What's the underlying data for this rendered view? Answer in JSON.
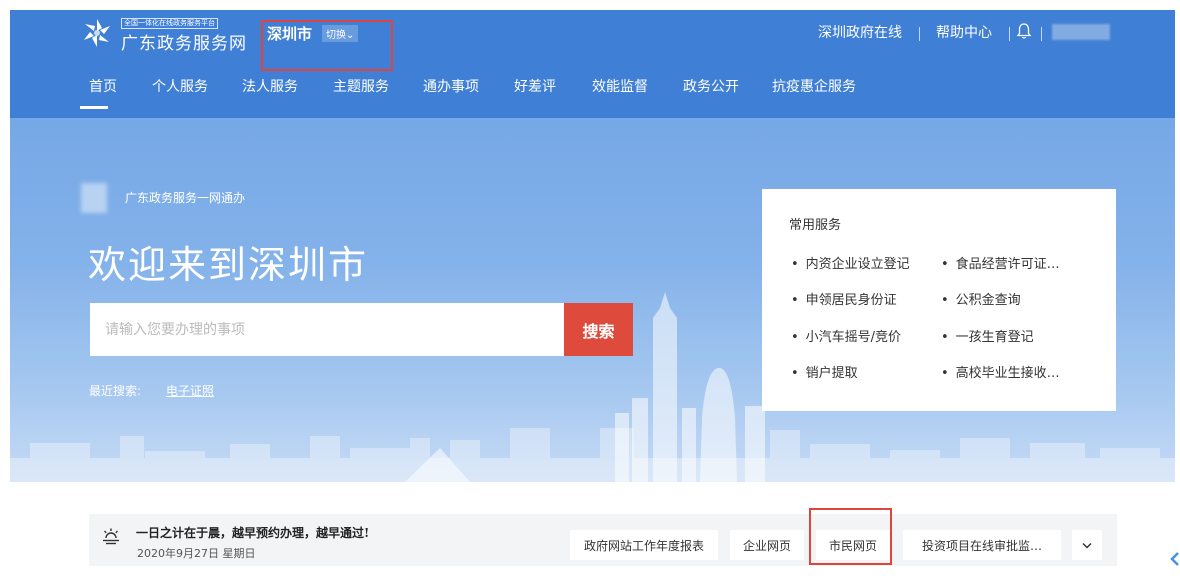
{
  "header": {
    "logo_tag": "全国一体化在线政务服务平台",
    "logo_title": "广东政务服务网",
    "city": "深圳市",
    "switch_label": "切换",
    "switch_chevron": "⌄",
    "gov_online": "深圳政府在线",
    "help_center": "帮助中心",
    "bell_icon": "bell-icon"
  },
  "nav": {
    "items": [
      {
        "label": "首页",
        "active": true
      },
      {
        "label": "个人服务"
      },
      {
        "label": "法人服务"
      },
      {
        "label": "主题服务"
      },
      {
        "label": "通办事项"
      },
      {
        "label": "好差评"
      },
      {
        "label": "效能监督"
      },
      {
        "label": "政务公开"
      },
      {
        "label": "抗疫惠企服务"
      }
    ]
  },
  "hero": {
    "subtitle": "广东政务服务一网通办",
    "title": "欢迎来到深圳市",
    "search_placeholder": "请输入您要办理的事项",
    "search_button": "搜索",
    "recent_label": "最近搜索:",
    "recent_link": "电子证照"
  },
  "services": {
    "title": "常用服务",
    "items": [
      "内资企业设立登记",
      "食品经营许可证…",
      "申领居民身份证",
      "公积金查询",
      "小汽车摇号/竞价",
      "一孩生育登记",
      "销户提取",
      "高校毕业生接收…"
    ]
  },
  "notice": {
    "text": "一日之计在于晨，越早预约办理，越早通过!",
    "date": "2020年9月27日 星期日",
    "chips": [
      "政府网站工作年度报表",
      "企业网页",
      "市民网页",
      "投资项目在线审批监…"
    ],
    "more_chevron": "⌄"
  },
  "colors": {
    "header_bg": "#3f7fd6",
    "search_button": "#de4b3c",
    "highlight_box": "#e0443c"
  }
}
